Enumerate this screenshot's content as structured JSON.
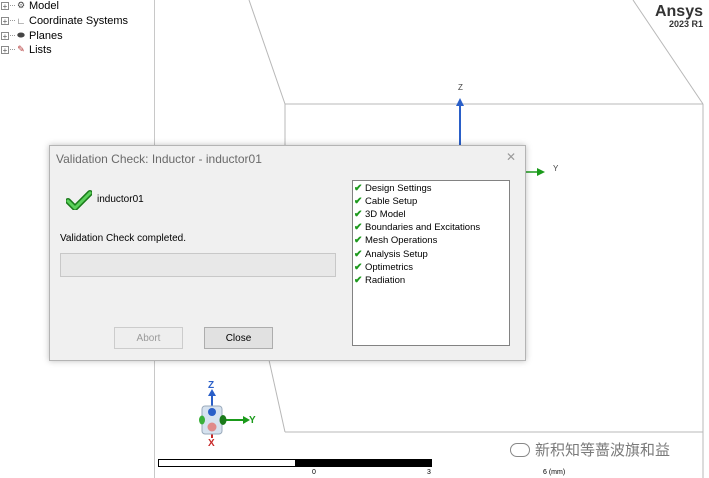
{
  "tree": {
    "items": [
      {
        "label": "Model",
        "icon": "model-icon"
      },
      {
        "label": "Coordinate Systems",
        "icon": "coordinate-systems-icon"
      },
      {
        "label": "Planes",
        "icon": "planes-icon"
      },
      {
        "label": "Lists",
        "icon": "lists-icon"
      }
    ]
  },
  "viewport": {
    "brand_name": "Ansys",
    "brand_version": "2023 R1",
    "axis_z": "Z",
    "axis_y": "Y",
    "triad": {
      "z": "Z",
      "y": "Y",
      "x": "X"
    },
    "scale": {
      "ticks": [
        "0",
        "3",
        "6 (mm)"
      ]
    },
    "watermark": "新积知等蔷波旗和益"
  },
  "dialog": {
    "title": "Validation Check: Inductor - inductor01",
    "close_icon": "close-icon",
    "instance_name": "inductor01",
    "status": "Validation Check completed.",
    "buttons": {
      "abort": "Abort",
      "close": "Close"
    },
    "checks": [
      {
        "label": "Design Settings",
        "status": "passed"
      },
      {
        "label": "Cable Setup",
        "status": "passed"
      },
      {
        "label": "3D Model",
        "status": "passed"
      },
      {
        "label": "Boundaries and Excitations",
        "status": "passed"
      },
      {
        "label": "Mesh Operations",
        "status": "passed"
      },
      {
        "label": "Analysis Setup",
        "status": "passed"
      },
      {
        "label": "Optimetrics",
        "status": "passed"
      },
      {
        "label": "Radiation",
        "status": "passed"
      }
    ]
  },
  "colors": {
    "accent_blue": "#2a5fc8",
    "check_green": "#1e9a1e",
    "axis_green": "#1a9a1a",
    "axis_red": "#c82828"
  }
}
